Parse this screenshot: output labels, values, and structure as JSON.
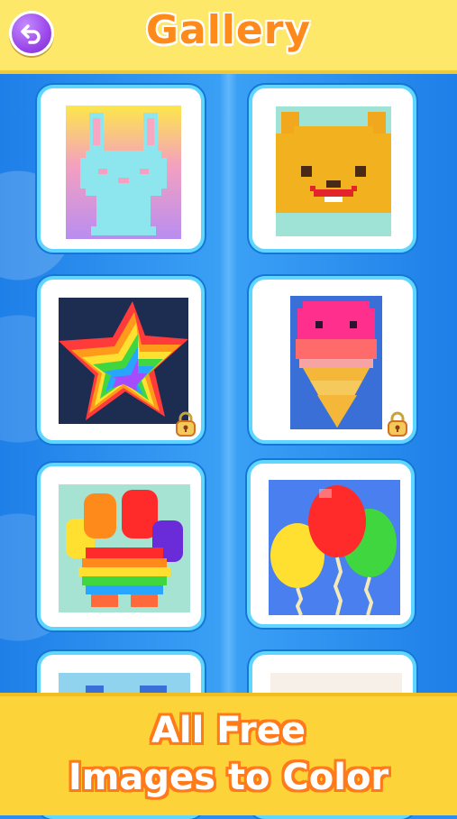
{
  "header": {
    "title": "Gallery",
    "back_icon": "undo-arrow-icon"
  },
  "gallery": {
    "items": [
      {
        "name": "bunny",
        "locked": false
      },
      {
        "name": "cat",
        "locked": false
      },
      {
        "name": "rainbow-star",
        "locked": true
      },
      {
        "name": "ice-cream",
        "locked": true
      },
      {
        "name": "rainbow-paw",
        "locked": false
      },
      {
        "name": "balloons",
        "locked": false
      },
      {
        "name": "partial-left",
        "locked": false
      },
      {
        "name": "partial-right",
        "locked": false
      }
    ]
  },
  "footer": {
    "line1": "All Free",
    "line2": "Images to Color"
  },
  "colors": {
    "header_bg": "#fde86a",
    "title": "#ff8a1c",
    "back_button": "#9b48ea",
    "card_border": "#5fd6ff",
    "footer_bg": "#fcd338",
    "footer_text_outline": "#ff7a1a"
  }
}
